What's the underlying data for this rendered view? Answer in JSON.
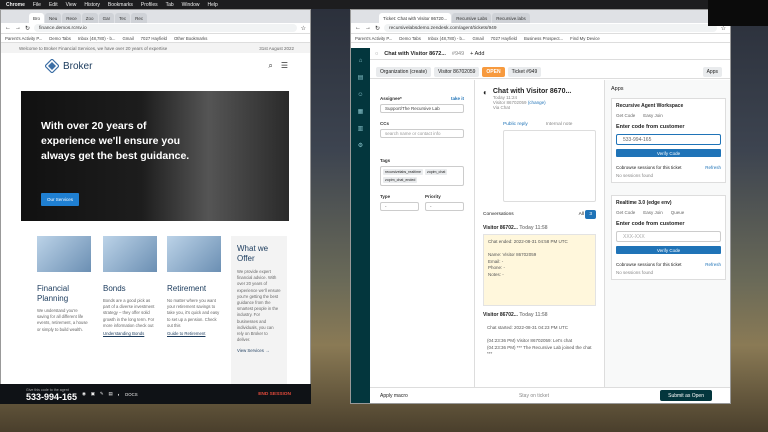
{
  "menubar": {
    "items": [
      "Chrome",
      "File",
      "Edit",
      "View",
      "History",
      "Bookmarks",
      "Profiles",
      "Tab",
      "Window",
      "Help"
    ]
  },
  "left_browser": {
    "tabs": [
      "Bro",
      "Neu",
      "Rece",
      "Zoo",
      "Gar",
      "Tec",
      "Rec"
    ],
    "url": "finance.demos.rcrsv.io",
    "bookmarks": [
      "Parent's Activity P...",
      "Demo Tabs",
      "Inbox (48,780) - b...",
      "Gmail",
      "7027 Hayfield",
      "Other Bookmarks"
    ],
    "notice": "Welcome to Broker Financial Services, we have over 20 years of expertise",
    "date": "31st August 2022",
    "logo_text": "Broker",
    "hero_title": "With over 20 years of experience we'll ensure you always get the best guidance.",
    "hero_button": "Our Services",
    "cards": [
      {
        "title": "Financial Planning",
        "text": "We understand you're saving for all different life events, retirement, a house or simply to build wealth.",
        "link": ""
      },
      {
        "title": "Bonds",
        "text": "Bonds are a good pick as part of a diverse investment strategy – they offer solid growth in the long term. For more information check out",
        "link": "Understanding Bonds"
      },
      {
        "title": "Retirement",
        "text": "No matter where you want your retirement savings to take you, it's quick and easy to set up a pension. Check out this",
        "link": "Guide to Retirement"
      }
    ],
    "side_card": {
      "title": "What we Offer",
      "text": "We provide expert financial advice. With over 20 years of experience we'll ensure you're getting the best guidance from the smartest people in the industry. For businesses and individuals, you can rely on Broker to deliver.",
      "link": "View Services →"
    },
    "hide_bar": "▾ HIDE BOTTOM BAR"
  },
  "sharebar": {
    "hint": "Give this code to the agent",
    "code": "533-994-165",
    "docs": "DOCS",
    "end": "END SESSION"
  },
  "right_browser": {
    "tabs": [
      "Ticket: Chat with Visitor 86720...",
      "Recursive Labs",
      "Recursive.labs"
    ],
    "url": "recursivelabsdemo.zendesk.com/agent/tickets/949",
    "bookmarks": [
      "Parent's Activity P...",
      "Demo Tabs",
      "Inbox (48,780) - b...",
      "Gmail",
      "7027 Hayfield",
      "Business Prospect...",
      "Find My Device"
    ],
    "ticket_tab": "Chat with Visitor 8672...",
    "ticket_id": "#949",
    "add": "+ Add",
    "breadcrumb": [
      "Organization (create)",
      "Visitor 86702059"
    ],
    "status_badge": "OPEN",
    "ticket_label": "Ticket #949",
    "apps_btn": "Apps",
    "assignee_label": "Assignee*",
    "take_it": "take it",
    "assignee_value": "Support/The Recursive Lab",
    "ccs_label": "CCs",
    "cc_placeholder": "search name or contact info",
    "tags_label": "Tags",
    "tags": [
      "recursivelabs_realtime",
      "zopim_chat",
      "zopim_chat_ended"
    ],
    "type_label": "Type",
    "priority_label": "Priority",
    "dash": "-",
    "conv_title": "Chat with Visitor 8670...",
    "conv_time": "Today 11:24",
    "conv_from": "Visitor 86702059",
    "conv_change": "(change)",
    "conv_via": "Via Chat",
    "reply_tabs": [
      "Public reply",
      "Internal note"
    ],
    "conv_filter": "Conversations",
    "conv_all": "All",
    "conv_count": "3",
    "messages": [
      {
        "author": "Visitor 86702...",
        "time": "Today 11:58",
        "body": "Chat ended: 2022-08-31 04:58 PM UTC\n\nName: Visitor 86702059\nEmail: -\nPhone: -\nNotes: -"
      },
      {
        "author": "Visitor 86702...",
        "time": "Today 11:58",
        "body": "Chat started: 2022-08-31 04:23 PM UTC\n\n(04:23:36 PM) Visitor 86702059: Let's chat\n(04:23:36 PM) *** The Recursive Lab joined the chat ***"
      }
    ],
    "apps_title": "Apps",
    "app1": {
      "title": "Recursive Agent Workspace",
      "tabs": [
        "Get Code",
        "Easy Join"
      ],
      "heading": "Enter code from customer",
      "code": "533-994-165",
      "verify": "Verify Code",
      "sessions": "Cobrowse sessions for this ticket",
      "refresh": "Refresh",
      "none": "No sessions found"
    },
    "app2": {
      "title": "Realtime 3.0 (edge env)",
      "tabs": [
        "Get Code",
        "Easy Join",
        "Queue"
      ],
      "heading": "Enter code from customer",
      "placeholder": "XXX-XXX",
      "verify": "Verify Code",
      "sessions": "Cobrowse sessions for this ticket",
      "refresh": "Refresh",
      "none": "No sessions found"
    },
    "apply_macro": "Apply macro",
    "stay": "Stay on ticket",
    "submit": "Submit as Open"
  }
}
